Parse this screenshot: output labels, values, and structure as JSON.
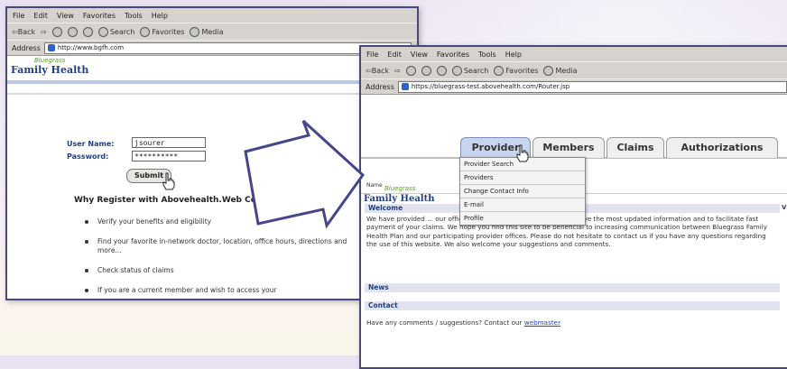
{
  "win1": {
    "menu": [
      "File",
      "Edit",
      "View",
      "Favorites",
      "Tools",
      "Help"
    ],
    "toolbar": {
      "back": "⇦Back",
      "forward": "⇨",
      "search": "Search",
      "favorites": "Favorites",
      "media": "Media"
    },
    "address_label": "Address",
    "url": "http://www.bgfh.com",
    "logo_small": "Bluegrass",
    "logo_big": "Family Health",
    "username_label": "User Name:",
    "username_value": "jsourer",
    "password_label": "Password:",
    "password_value": "**********",
    "submit_label": "Submit",
    "why_heading": "Why Register with Abovehealth.Web Community",
    "bullets": [
      "Verify your benefits and eligibility",
      "Find your favorite in-network doctor, location, office hours, directions and more...",
      "Check status of claims",
      "If you are a current member and wish to access your"
    ]
  },
  "win2": {
    "menu": [
      "File",
      "Edit",
      "View",
      "Favorites",
      "Tools",
      "Help"
    ],
    "toolbar": {
      "back": "⇦Back",
      "forward": "⇨",
      "search": "Search",
      "favorites": "Favorites",
      "media": "Media"
    },
    "address_label": "Address",
    "url": "https://bluegrass-test.abovehealth.com/Router.jsp",
    "logo_small": "Bluegrass",
    "logo_big": "Family Health",
    "tabs": [
      "Provider",
      "Members",
      "Claims",
      "Authorizations"
    ],
    "dropdown": [
      "Provider Search",
      "Providers",
      "Change Contact Info",
      "E-mail",
      "Profile"
    ],
    "name_label": "Name",
    "welcome_head": "Welcome",
    "welcome_text": "We have provided ... our office demographics to ensure that we have the most updated information and to facilitate fast payment of your claims. We hope you find this site to be beneficial to increasing communication between Bluegrass Family Health Plan and our participating provider offices. Please do not hesitate to contact us if you have any questions regarding the use of this website. We also welcome your suggestions and comments.",
    "news_head": "News",
    "contact_head": "Contact",
    "contact_text": "Have any comments / suggestions? Contact our",
    "webmaster": "webmaster",
    "edge_label": "V"
  },
  "colors": {
    "window_border": "#47497a",
    "brand_blue": "#1f3f82",
    "brand_green": "#5e9c2f",
    "arrow_outline": "#46468a"
  },
  "icons": [
    "ie-icon",
    "back-arrow-icon",
    "forward-arrow-icon",
    "stop-icon",
    "refresh-icon",
    "home-icon",
    "search-icon",
    "favorites-icon",
    "media-icon",
    "pointer-arrow-icon",
    "hand-cursor-icon"
  ]
}
